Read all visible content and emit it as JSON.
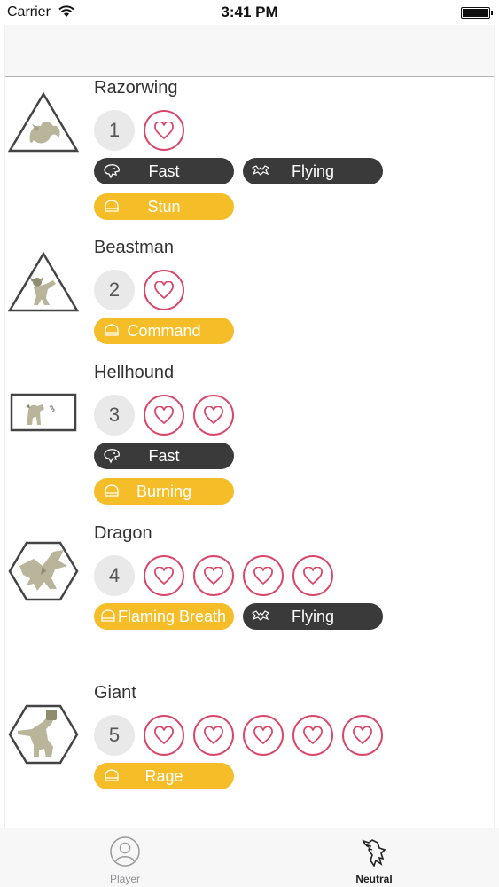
{
  "status_bar": {
    "carrier": "Carrier",
    "time": "3:41 PM"
  },
  "colors": {
    "heart": "#d9476a",
    "pill_dark": "#3a3a3a",
    "pill_yellow": "#f5be28",
    "rank_bg": "#e9e9e9"
  },
  "units": [
    {
      "name": "Razorwing",
      "rank": "1",
      "hearts": 1,
      "icon": "triangle-razorwing-icon",
      "abilities": [
        {
          "label": "Fast",
          "style": "dark",
          "icon": "beast-head-icon"
        },
        {
          "label": "Flying",
          "style": "dark",
          "icon": "bat-icon"
        },
        {
          "label": "Stun",
          "style": "yellow",
          "icon": "helmet-icon"
        }
      ]
    },
    {
      "name": "Beastman",
      "rank": "2",
      "hearts": 1,
      "icon": "triangle-beastman-icon",
      "abilities": [
        {
          "label": "Command",
          "style": "yellow",
          "icon": "helmet-icon"
        }
      ]
    },
    {
      "name": "Hellhound",
      "rank": "3",
      "hearts": 2,
      "icon": "rectangle-hellhound-icon",
      "abilities": [
        {
          "label": "Fast",
          "style": "dark",
          "icon": "beast-head-icon"
        },
        {
          "label": "Burning",
          "style": "yellow",
          "icon": "helmet-icon"
        }
      ]
    },
    {
      "name": "Dragon",
      "rank": "4",
      "hearts": 4,
      "icon": "hexagon-dragon-icon",
      "abilities": [
        {
          "label": "Flaming Breath",
          "style": "yellow",
          "icon": "helmet-icon"
        },
        {
          "label": "Flying",
          "style": "dark",
          "icon": "bat-icon"
        }
      ]
    },
    {
      "name": "Giant",
      "rank": "5",
      "hearts": 5,
      "icon": "hexagon-giant-icon",
      "abilities": [
        {
          "label": "Rage",
          "style": "yellow",
          "icon": "helmet-icon"
        }
      ]
    }
  ],
  "tab_bar": {
    "tabs": [
      {
        "label": "Player",
        "icon": "player-icon",
        "selected": false
      },
      {
        "label": "Neutral",
        "icon": "wolf-icon",
        "selected": true
      }
    ]
  }
}
